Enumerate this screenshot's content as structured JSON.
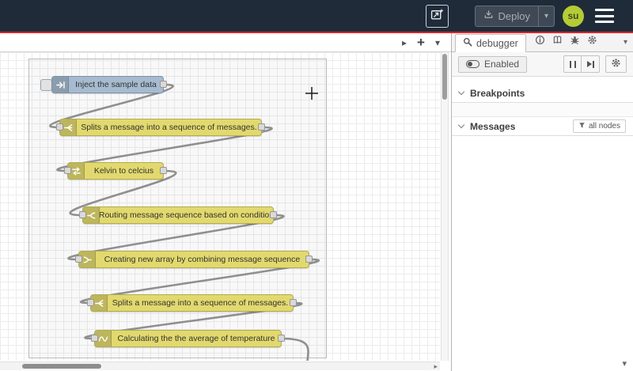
{
  "header": {
    "deploy": {
      "label": "Deploy"
    },
    "avatar": {
      "initials": "su"
    }
  },
  "workspace": {
    "nodes": [
      {
        "type": "inject",
        "label": "Inject the sample data"
      },
      {
        "type": "split",
        "label": "Splits a message into a sequence of messages."
      },
      {
        "type": "change",
        "label": "Kelvin to celcius"
      },
      {
        "type": "switch",
        "label": "Routing message sequence based on condition"
      },
      {
        "type": "join",
        "label": "Creating new array by combining message sequence"
      },
      {
        "type": "split",
        "label": "Splits a message into a sequence of messages."
      },
      {
        "type": "smooth",
        "label": "Calculating the the average of temperature"
      }
    ]
  },
  "sidebar": {
    "tabs": {
      "active_label": "debugger"
    },
    "toolbar": {
      "enabled_label": "Enabled"
    },
    "sections": {
      "breakpoints": {
        "title": "Breakpoints"
      },
      "messages": {
        "title": "Messages",
        "filter_label": "all nodes"
      }
    }
  },
  "icons": {
    "caret_down": "▾",
    "caret_right": "▸",
    "plus": "+"
  },
  "colors": {
    "header_bg": "#1f2b39",
    "accent_red": "#d9252c",
    "inject_node": "#a6bbcf",
    "function_node": "#e2d96e",
    "avatar_bg": "#b5cc35",
    "wire": "#8f8f8f"
  }
}
